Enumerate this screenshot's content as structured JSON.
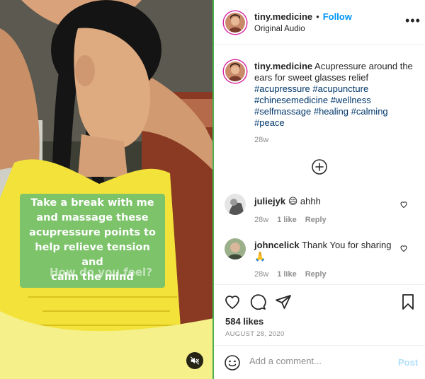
{
  "header": {
    "username": "tiny.medicine",
    "separator": "•",
    "follow_label": "Follow",
    "audio_label": "Original Audio",
    "more_label": "•••"
  },
  "media": {
    "overlay_lines": [
      "Take a break with me",
      "and massage these",
      "acupressure points to",
      "help relieve tension and",
      "calm the mind"
    ],
    "overlay_question": "How do you feel?",
    "mute_icon": "muted-speaker-icon"
  },
  "caption": {
    "username": "tiny.medicine",
    "text": "Acupressure around the ears for sweet glasses relief",
    "hashtags": [
      "#acupressure",
      "#acupuncture",
      "#chinesemedicine",
      "#wellness",
      "#selfmassage",
      "#healing",
      "#calming",
      "#peace"
    ],
    "time": "28w"
  },
  "comments": [
    {
      "username": "juliejyk",
      "emoji": "😄",
      "text": "ahhh",
      "time": "28w",
      "likes": "1 like",
      "reply": "Reply"
    },
    {
      "username": "johncelick",
      "text": "Thank You for sharing",
      "emoji": "🙏",
      "time": "28w",
      "likes": "1 like",
      "reply": "Reply"
    }
  ],
  "actions": {
    "likes": "584 likes",
    "date": "AUGUST 28, 2020"
  },
  "add_comment": {
    "placeholder": "Add a comment...",
    "post_label": "Post"
  },
  "colors": {
    "link": "#0095f6",
    "hashtag": "#00376b",
    "overlay_bg": "#7cc36a",
    "post_disabled": "#b2dffc"
  }
}
